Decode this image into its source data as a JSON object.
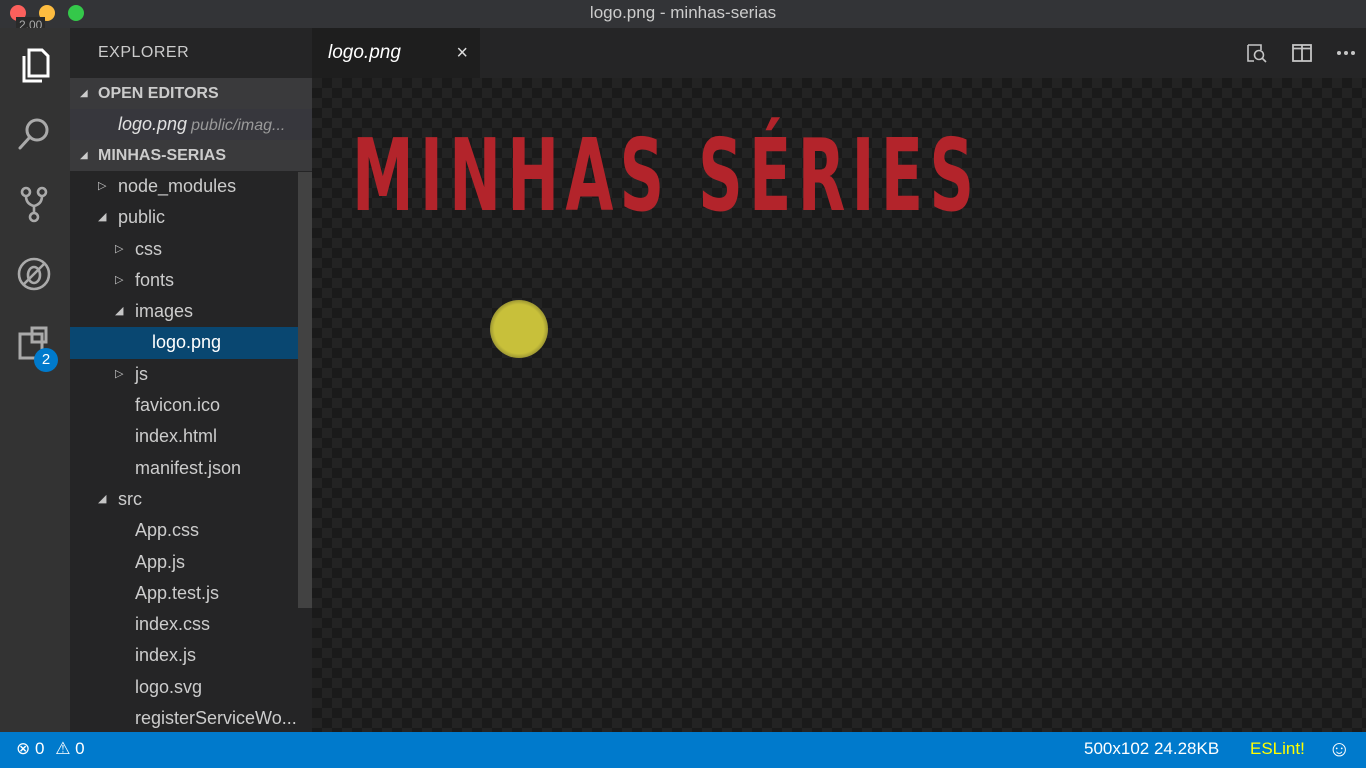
{
  "window": {
    "title": "logo.png - minhas-serias",
    "zoom_badge": "2.00",
    "traffic_colors": [
      "#fc605c",
      "#fdbc40",
      "#34c84a"
    ]
  },
  "activity_bar": {
    "icons": [
      "files-icon",
      "search-icon",
      "source-control-icon",
      "debug-icon",
      "extensions-icon"
    ],
    "extensions_badge": "2"
  },
  "explorer": {
    "title": "EXPLORER",
    "open_editors": {
      "header": "OPEN EDITORS",
      "items": [
        {
          "name": "logo.png",
          "path": "public/imag..."
        }
      ]
    },
    "project": {
      "header": "MINHAS-SERIAS",
      "tree": [
        {
          "label": "node_modules",
          "type": "folder",
          "expanded": false,
          "depth": 0
        },
        {
          "label": "public",
          "type": "folder",
          "expanded": true,
          "depth": 0
        },
        {
          "label": "css",
          "type": "folder",
          "expanded": false,
          "depth": 1
        },
        {
          "label": "fonts",
          "type": "folder",
          "expanded": false,
          "depth": 1
        },
        {
          "label": "images",
          "type": "folder",
          "expanded": true,
          "depth": 1
        },
        {
          "label": "logo.png",
          "type": "file",
          "selected": true,
          "depth": 2
        },
        {
          "label": "js",
          "type": "folder",
          "expanded": false,
          "depth": 1
        },
        {
          "label": "favicon.ico",
          "type": "file",
          "depth": 1
        },
        {
          "label": "index.html",
          "type": "file",
          "depth": 1
        },
        {
          "label": "manifest.json",
          "type": "file",
          "depth": 1
        },
        {
          "label": "src",
          "type": "folder",
          "expanded": true,
          "depth": 0
        },
        {
          "label": "App.css",
          "type": "file",
          "depth": 1
        },
        {
          "label": "App.js",
          "type": "file",
          "depth": 1
        },
        {
          "label": "App.test.js",
          "type": "file",
          "depth": 1
        },
        {
          "label": "index.css",
          "type": "file",
          "depth": 1
        },
        {
          "label": "index.js",
          "type": "file",
          "depth": 1
        },
        {
          "label": "logo.svg",
          "type": "file",
          "depth": 1
        },
        {
          "label": "registerServiceWo...",
          "type": "file",
          "depth": 1
        }
      ]
    }
  },
  "editor": {
    "tab_label": "logo.png",
    "close_glyph": "×",
    "image_text": "MINHAS SÉRIES",
    "image_text_color": "#b3242b"
  },
  "status_bar": {
    "errors": "0",
    "warnings": "0",
    "image_info": "500x102 24.28KB",
    "eslint": "ESLint!",
    "accent": "#007acc"
  }
}
